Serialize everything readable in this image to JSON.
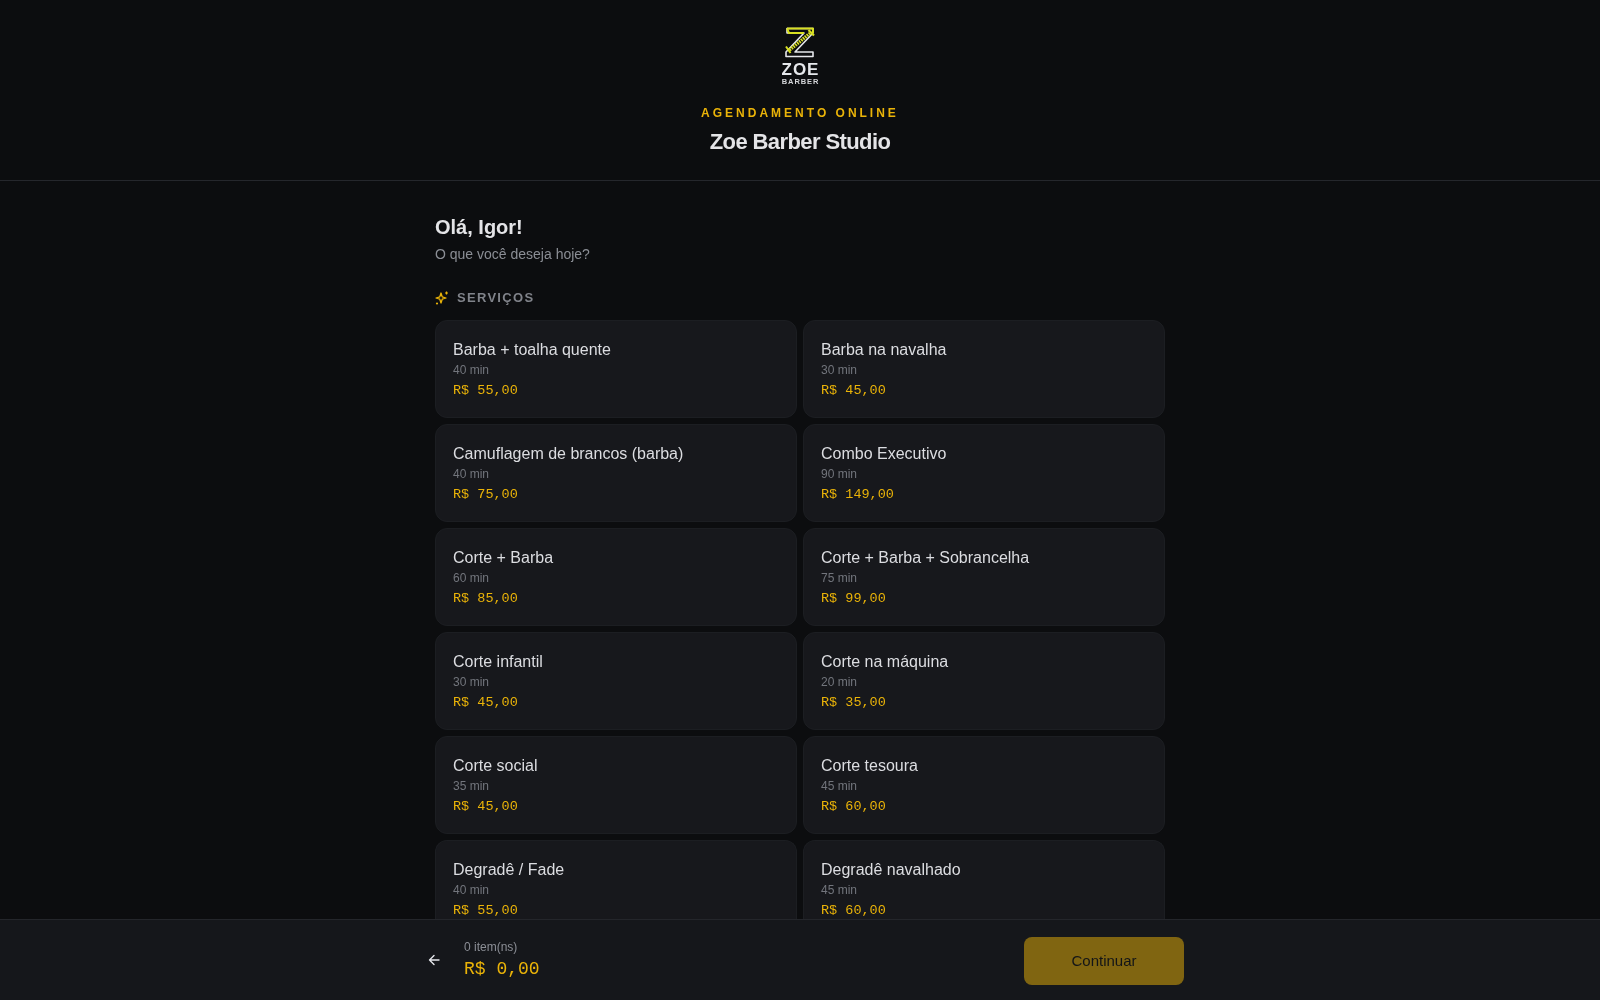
{
  "header": {
    "logo": {
      "wordmark": "ZOE",
      "tagline": "BARBER"
    },
    "eyebrow": "AGENDAMENTO ONLINE",
    "title": "Zoe Barber Studio"
  },
  "greeting": {
    "title": "Olá, Igor!",
    "subtitle": "O que você deseja hoje?"
  },
  "services": {
    "heading": "SERVIÇOS",
    "items": [
      {
        "name": "Barba + toalha quente",
        "duration": "40 min",
        "price": "R$ 55,00",
        "selected": false
      },
      {
        "name": "Barba na navalha",
        "duration": "30 min",
        "price": "R$ 45,00",
        "selected": false
      },
      {
        "name": "Camuflagem de brancos (barba)",
        "duration": "40 min",
        "price": "R$ 75,00",
        "selected": false
      },
      {
        "name": "Combo Executivo",
        "duration": "90 min",
        "price": "R$ 149,00",
        "selected": false
      },
      {
        "name": "Corte + Barba",
        "duration": "60 min",
        "price": "R$ 85,00",
        "selected": false
      },
      {
        "name": "Corte + Barba + Sobrancelha",
        "duration": "75 min",
        "price": "R$ 99,00",
        "selected": false
      },
      {
        "name": "Corte infantil",
        "duration": "30 min",
        "price": "R$ 45,00",
        "selected": false
      },
      {
        "name": "Corte na máquina",
        "duration": "20 min",
        "price": "R$ 35,00",
        "selected": false
      },
      {
        "name": "Corte social",
        "duration": "35 min",
        "price": "R$ 45,00",
        "selected": false
      },
      {
        "name": "Corte tesoura",
        "duration": "45 min",
        "price": "R$ 60,00",
        "selected": false
      },
      {
        "name": "Degradê / Fade",
        "duration": "40 min",
        "price": "R$ 55,00",
        "selected": false
      },
      {
        "name": "Degradê navalhado",
        "duration": "45 min",
        "price": "R$ 60,00",
        "selected": false
      }
    ]
  },
  "footer": {
    "count": "0 item(ns)",
    "total": "R$ 0,00",
    "button": {
      "label": "Continuar",
      "disabled": true
    }
  }
}
